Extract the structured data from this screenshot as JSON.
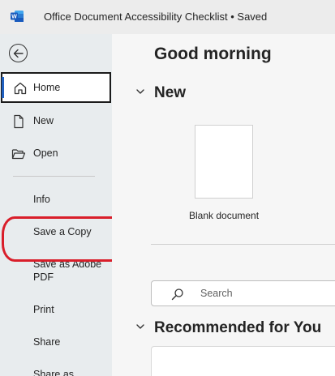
{
  "titlebar": {
    "title": "Office Document Accessibility Checklist • Saved",
    "app_icon": "word-icon"
  },
  "sidebar": {
    "back_icon": "back-arrow-icon",
    "items": [
      {
        "label": "Home",
        "icon": "home-icon",
        "active": true
      },
      {
        "label": "New",
        "icon": "new-document-icon"
      },
      {
        "label": "Open",
        "icon": "folder-open-icon"
      }
    ],
    "text_items": [
      {
        "label": "Info"
      },
      {
        "label": "Save a Copy"
      },
      {
        "label": "Save as Adobe PDF"
      },
      {
        "label": "Print"
      },
      {
        "label": "Share"
      },
      {
        "label": "Share as"
      }
    ]
  },
  "main": {
    "greeting": "Good morning",
    "new_section": {
      "title": "New",
      "templates": [
        {
          "label": "Blank document"
        }
      ]
    },
    "search": {
      "placeholder": "Search"
    },
    "recommended": {
      "title": "Recommended for You"
    }
  },
  "colors": {
    "accent_blue": "#1f5fbf",
    "highlight_red": "#d91e2a",
    "word_blue": "#185abd"
  }
}
